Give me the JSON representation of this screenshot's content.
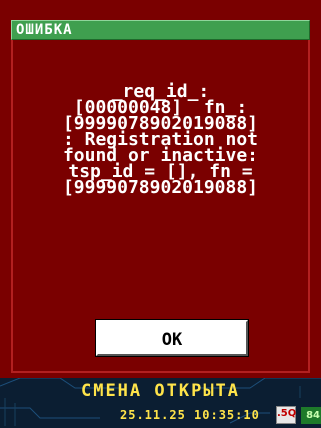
{
  "dialog": {
    "title": "ОШИБКА",
    "message": "_req_id_:\n[00000048]  fn_:\n[9999078902019088]\n: Registration not\nfound or inactive:\ntsp_id = [], fn =\n[9999078902019088]",
    "ok_label": "OK"
  },
  "status_bar": {
    "shift_status": "СМЕНА ОТКРЫТА",
    "datetime": "25.11.25 10:35:10",
    "network_indicator": ".5Q",
    "battery_level": "84"
  },
  "colors": {
    "dialog_background": "#7a0000",
    "title_bar": "#3f9f4f",
    "status_text": "#ffe44a",
    "status_background": "#0b1e32"
  },
  "icons": {
    "network": "network-status-icon",
    "battery": "battery-icon"
  }
}
